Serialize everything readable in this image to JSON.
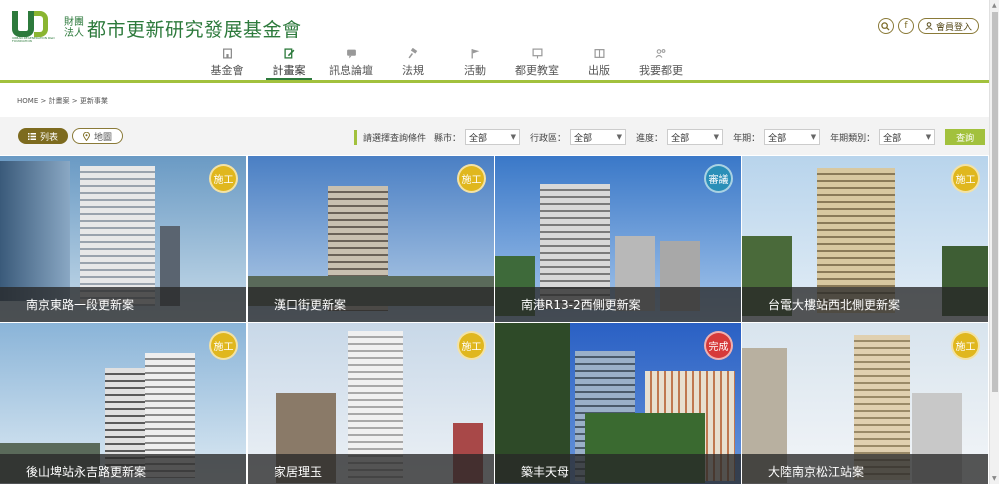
{
  "brand": {
    "logo_small_top": "財團",
    "logo_small_bottom": "法人",
    "title": "都市更新研究發展基金會",
    "logo_letters": "UR",
    "logo_sub": "URBAN REGENERATION R&D FOUNDATION"
  },
  "header_tools": {
    "search_glyph": "🔍",
    "fb_glyph": "f",
    "login_label": "會員登入"
  },
  "nav": [
    {
      "label": "基金會",
      "icon": "building-icon"
    },
    {
      "label": "計畫案",
      "icon": "edit-document-icon",
      "active": true
    },
    {
      "label": "訊息論壇",
      "icon": "chat-icon"
    },
    {
      "label": "法規",
      "icon": "gavel-icon"
    },
    {
      "label": "活動",
      "icon": "flag-icon"
    },
    {
      "label": "都更教室",
      "icon": "board-icon"
    },
    {
      "label": "出版",
      "icon": "book-icon"
    },
    {
      "label": "我要都更",
      "icon": "people-icon"
    }
  ],
  "breadcrumb": "HOME > 計畫案 > 更新事業",
  "view": {
    "list_label": "列表",
    "map_label": "地圖"
  },
  "filters": {
    "prompt": "請選擇查詢條件",
    "fields": [
      {
        "label": "縣市：",
        "value": "全部"
      },
      {
        "label": "行政區：",
        "value": "全部"
      },
      {
        "label": "進度：",
        "value": "全部"
      },
      {
        "label": "年期：",
        "value": "全部"
      },
      {
        "label": "年期類別：",
        "value": "全部"
      }
    ],
    "submit_label": "查詢"
  },
  "projects": [
    {
      "name": "南京東路一段更新案",
      "status": "施工",
      "status_color": "#e0b71e"
    },
    {
      "name": "漢口街更新案",
      "status": "施工",
      "status_color": "#e0b71e"
    },
    {
      "name": "南港R13-2西側更新案",
      "status": "審議",
      "status_color": "#2a8fb8"
    },
    {
      "name": "台電大樓站西北側更新案",
      "status": "施工",
      "status_color": "#e0b71e"
    },
    {
      "name": "後山埤站永吉路更新案",
      "status": "施工",
      "status_color": "#e0b71e"
    },
    {
      "name": "家居理玉",
      "status": "施工",
      "status_color": "#e0b71e"
    },
    {
      "name": "築丰天母",
      "status": "完成",
      "status_color": "#d63a3a"
    },
    {
      "name": "大陸南京松江站案",
      "status": "施工",
      "status_color": "#e0b71e"
    }
  ],
  "colors": {
    "brand_green": "#2d7a3c",
    "accent_lime": "#a2c13d",
    "toggle_brown": "#7d6b1f"
  }
}
